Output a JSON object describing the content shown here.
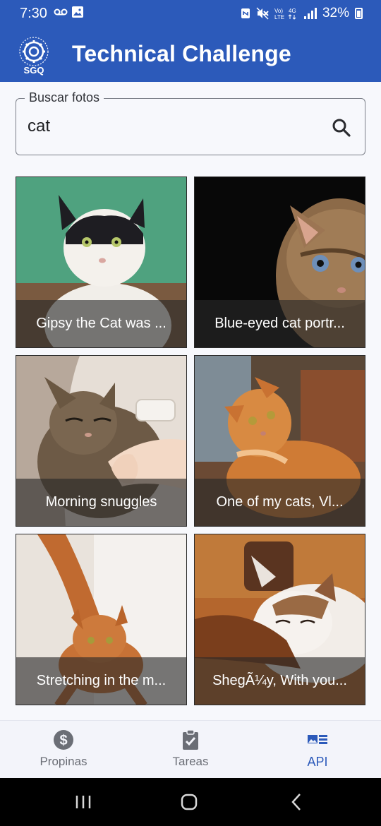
{
  "status_bar": {
    "time": "7:30",
    "network_text": "Vo) 4G\nLTE",
    "battery": "32%"
  },
  "app": {
    "title": "Technical Challenge",
    "logo_text": "SGQ"
  },
  "search": {
    "label": "Buscar fotos",
    "value": "cat",
    "icon": "search-icon"
  },
  "photos": [
    {
      "caption": "Gipsy the Cat was ..."
    },
    {
      "caption": "Blue-eyed cat portr..."
    },
    {
      "caption": "Morning snuggles"
    },
    {
      "caption": "One of my cats, Vl..."
    },
    {
      "caption": "Stretching in the m..."
    },
    {
      "caption": "ShegÃ¼y, With you..."
    }
  ],
  "bottom_nav": {
    "items": [
      {
        "label": "Propinas",
        "icon": "dollar-circle-icon"
      },
      {
        "label": "Tareas",
        "icon": "task-clipboard-icon"
      },
      {
        "label": "API",
        "icon": "image-list-icon"
      }
    ],
    "active": "API"
  },
  "colors": {
    "primary": "#2c5aba",
    "background": "#f7f8fc",
    "nav_inactive": "#6b6e76"
  }
}
